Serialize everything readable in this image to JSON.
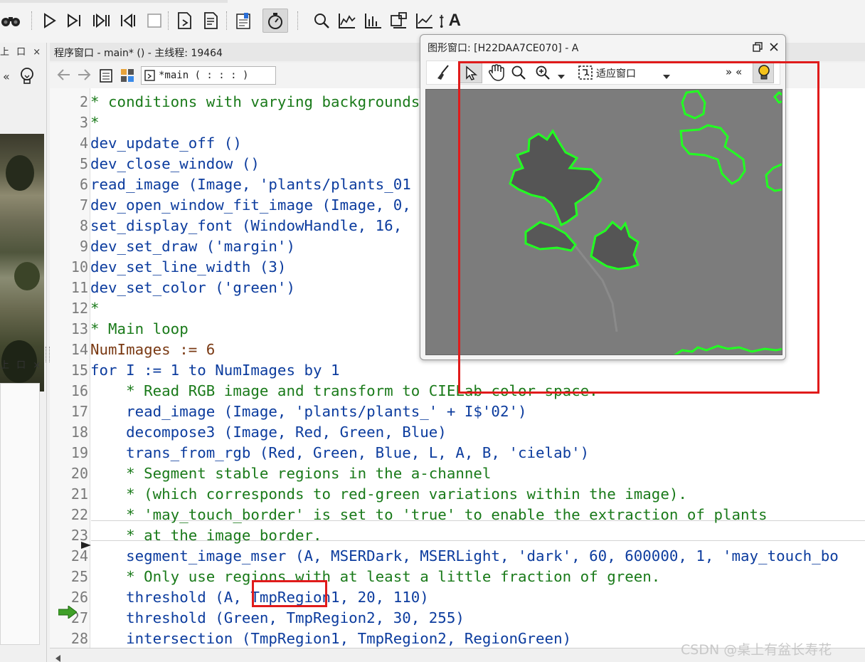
{
  "toolbar": {
    "buttons": [
      "binoculars-icon",
      "run-icon",
      "step-over-icon",
      "step-into-icon",
      "step-out-icon",
      "stop-icon",
      "insert-code-icon",
      "assistant-icon",
      "variable-inspect-icon",
      "profiler-icon",
      "zoom-icon",
      "histogram-icon",
      "line-profile-icon",
      "gray-histogram-icon",
      "feature-inspect-icon",
      "char-icon"
    ],
    "char_label": "A"
  },
  "left_panel": {
    "dock_glyphs": "上 口 ×",
    "nav_glyph": "«"
  },
  "program_window": {
    "title": "程序窗口 - main* () - 主线程: 19464",
    "procedure": "*main ( : : : )",
    "lines": [
      {
        "n": "2",
        "parts": [
          {
            "t": "* conditions with varying backgrounds",
            "c": "cmt"
          }
        ]
      },
      {
        "n": "3",
        "parts": [
          {
            "t": "*",
            "c": "cmt"
          }
        ]
      },
      {
        "n": "4",
        "parts": [
          {
            "t": "dev_update_off ()",
            "c": "op"
          }
        ]
      },
      {
        "n": "5",
        "parts": [
          {
            "t": "dev_close_window ()",
            "c": "op"
          }
        ]
      },
      {
        "n": "6",
        "parts": [
          {
            "t": "read_image (Image, ",
            "c": "op"
          },
          {
            "t": "'plants/plants_01",
            "c": "str"
          }
        ]
      },
      {
        "n": "7",
        "parts": [
          {
            "t": "dev_open_window_fit_image (Image, 0,",
            "c": "op"
          }
        ]
      },
      {
        "n": "8",
        "parts": [
          {
            "t": "set_display_font (WindowHandle, 16,",
            "c": "op"
          }
        ]
      },
      {
        "n": "9",
        "parts": [
          {
            "t": "dev_set_draw ('margin')",
            "c": "op"
          }
        ]
      },
      {
        "n": "10",
        "parts": [
          {
            "t": "dev_set_line_width (3)",
            "c": "op"
          }
        ]
      },
      {
        "n": "11",
        "parts": [
          {
            "t": "dev_set_color ('green')",
            "c": "op"
          }
        ]
      },
      {
        "n": "12",
        "parts": [
          {
            "t": "*",
            "c": "cmt"
          }
        ]
      },
      {
        "n": "13",
        "parts": [
          {
            "t": "* Main loop",
            "c": "cmt"
          }
        ]
      },
      {
        "n": "14",
        "parts": [
          {
            "t": "NumImages := 6",
            "c": "var"
          }
        ]
      },
      {
        "n": "15",
        "parts": [
          {
            "t": "for I := 1 to NumImages by 1",
            "c": "kw"
          }
        ]
      },
      {
        "n": "16",
        "parts": [
          {
            "t": "    * Read RGB image and transform to CIELab color space.",
            "c": "cmt"
          }
        ]
      },
      {
        "n": "17",
        "parts": [
          {
            "t": "    read_image (Image, 'plants/plants_' + I$'02')",
            "c": "op"
          }
        ]
      },
      {
        "n": "18",
        "parts": [
          {
            "t": "    decompose3 (Image, Red, Green, Blue)",
            "c": "op"
          }
        ]
      },
      {
        "n": "19",
        "parts": [
          {
            "t": "    trans_from_rgb (Red, Green, Blue, L, A, B, 'cielab')",
            "c": "op"
          }
        ]
      },
      {
        "n": "20",
        "parts": [
          {
            "t": "    * Segment stable regions in the a-channel",
            "c": "cmt"
          }
        ]
      },
      {
        "n": "21",
        "parts": [
          {
            "t": "    * (which corresponds to red-green variations within the image).",
            "c": "cmt"
          }
        ]
      },
      {
        "n": "22",
        "parts": [
          {
            "t": "    * 'may_touch_border' is set to 'true' to enable the extraction of plants",
            "c": "cmt"
          }
        ]
      },
      {
        "n": "23",
        "parts": [
          {
            "t": "    * at the image border.",
            "c": "cmt"
          }
        ]
      },
      {
        "n": "24",
        "parts": [
          {
            "t": "    segment_image_mser (A, MSERDark, MSERLight, 'dark', 60, 600000, 1, 'may_touch_bo",
            "c": "op"
          }
        ]
      },
      {
        "n": "25",
        "parts": [
          {
            "t": "    * Only use regions with at least a little fraction of green.",
            "c": "cmt"
          }
        ]
      },
      {
        "n": "26",
        "parts": [
          {
            "t": "    threshold (A, TmpRegion1, 20, 110)",
            "c": "op"
          }
        ]
      },
      {
        "n": "27",
        "parts": [
          {
            "t": "    threshold (Green, TmpRegion2, 30, 255)",
            "c": "op"
          }
        ]
      },
      {
        "n": "28",
        "parts": [
          {
            "t": "    intersection (TmpRegion1, TmpRegion2, RegionGreen)",
            "c": "op"
          }
        ]
      }
    ]
  },
  "graphics_window": {
    "title": "图形窗口: [H22DAA7CE070] - A",
    "fit_label": "适应窗口",
    "more_glyph": "» «"
  },
  "colors": {
    "region_outline": "#22ff22",
    "annotation": "#e01b1b",
    "canvas": "#7c7c7c"
  },
  "watermark": "CSDN @桌上有盆长寿花"
}
